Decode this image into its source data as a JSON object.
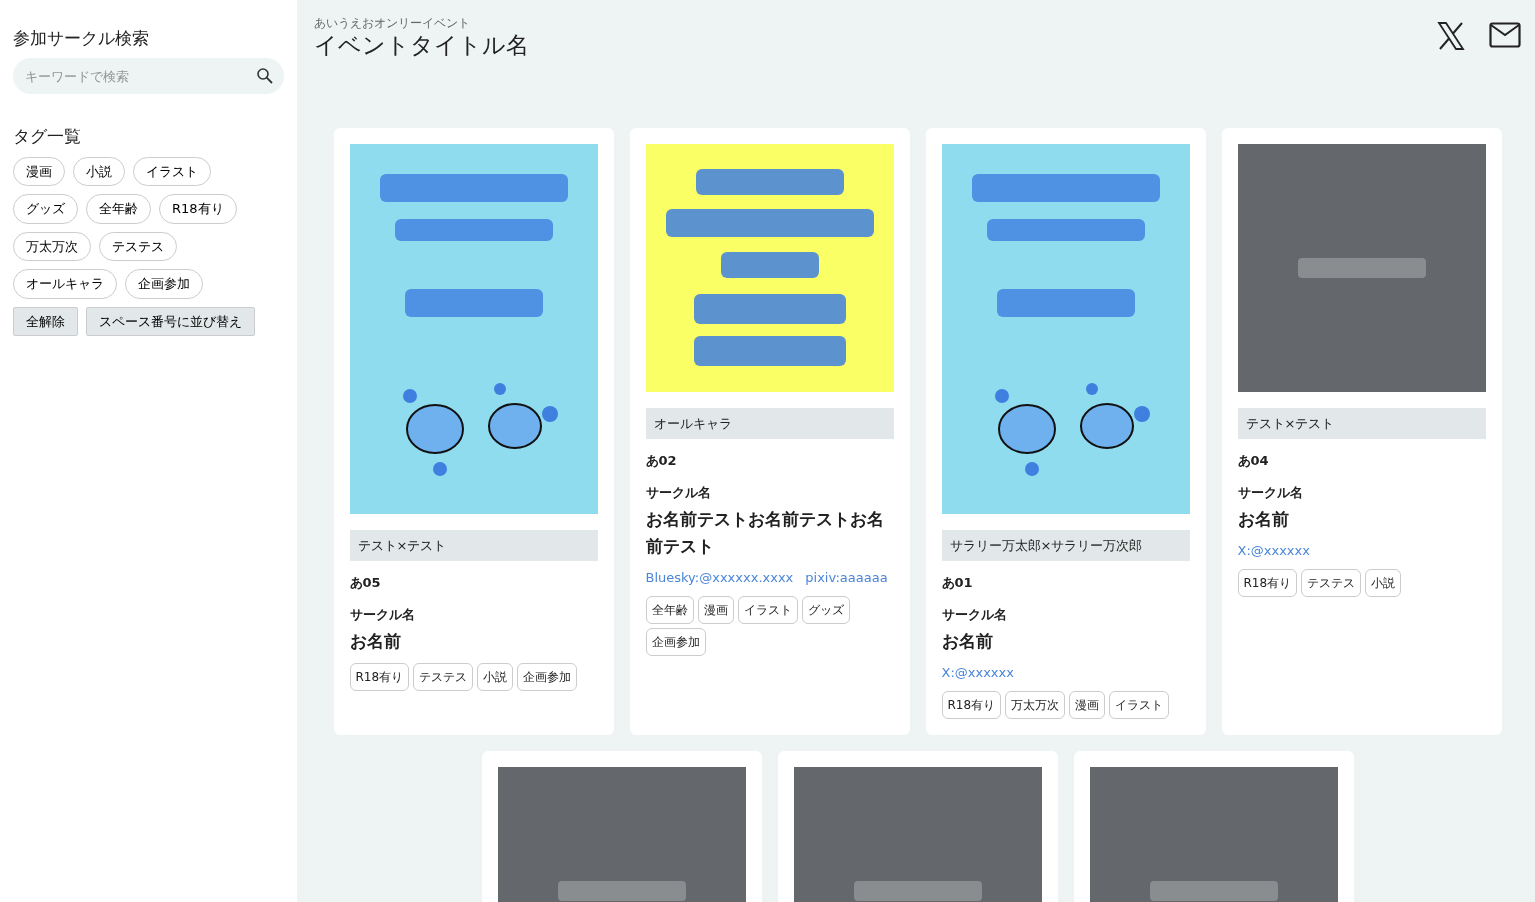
{
  "sidebar": {
    "search_title": "参加サークル検索",
    "search": {
      "placeholder": "キーワードで検索"
    },
    "tags_title": "タグ一覧",
    "tags": [
      "漫画",
      "小説",
      "イラスト",
      "グッズ",
      "全年齢",
      "R18有り",
      "万太万次",
      "テステス",
      "オールキャラ",
      "企画参加"
    ],
    "buttons": [
      "全解除",
      "スペース番号に並び替え"
    ]
  },
  "header": {
    "subtitle": "あいうえおオンリーイベント",
    "title": "イベントタイトル名"
  },
  "cards": [
    {
      "image": {
        "kind": "picture"
      },
      "pairing": "テスト×テスト",
      "space": "あ05",
      "circle_label": "サークル名",
      "name": "お名前",
      "tags": [
        "R18有り",
        "テステス",
        "小説",
        "企画参加"
      ]
    },
    {
      "image": {
        "kind": "picture"
      },
      "pairing": "オールキャラ",
      "space": "あ02",
      "circle_label": "サークル名",
      "name": "お名前テストお名前テストお名前テスト",
      "links": [
        "Bluesky:@xxxxxx.xxxx",
        "pixiv:aaaaaa"
      ],
      "tags": [
        "全年齢",
        "漫画",
        "イラスト",
        "グッズ",
        "企画参加"
      ]
    },
    {
      "image": {
        "kind": "picture"
      },
      "pairing": "サラリー万太郎×サラリー万次郎",
      "space": "あ01",
      "circle_label": "サークル名",
      "name": "お名前",
      "links": [
        "X:@xxxxxx"
      ],
      "tags": [
        "R18有り",
        "万太万次",
        "漫画",
        "イラスト"
      ]
    },
    {
      "image": {
        "kind": "picture"
      },
      "pairing": "テスト×テスト",
      "space": "あ04",
      "circle_label": "サークル名",
      "name": "お名前",
      "links": [
        "X:@xxxxxx"
      ],
      "tags": [
        "R18有り",
        "テステス",
        "小説"
      ]
    },
    {
      "image": {
        "kind": "picture"
      }
    },
    {
      "image": {
        "kind": "picture"
      }
    },
    {
      "image": {
        "kind": "picture"
      }
    }
  ]
}
